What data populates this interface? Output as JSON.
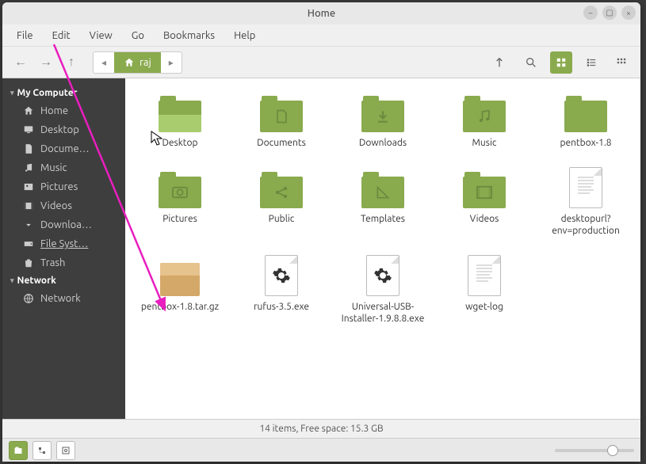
{
  "window": {
    "title": "Home"
  },
  "menu": {
    "items": [
      "File",
      "Edit",
      "View",
      "Go",
      "Bookmarks",
      "Help"
    ]
  },
  "path": {
    "current": "raj"
  },
  "sidebar": {
    "sections": [
      {
        "header": "My Computer",
        "items": [
          {
            "label": "Home",
            "icon": "home"
          },
          {
            "label": "Desktop",
            "icon": "desktop"
          },
          {
            "label": "Docume…",
            "icon": "doc"
          },
          {
            "label": "Music",
            "icon": "music"
          },
          {
            "label": "Pictures",
            "icon": "pic"
          },
          {
            "label": "Videos",
            "icon": "video"
          },
          {
            "label": "Downloa…",
            "icon": "down"
          },
          {
            "label": "File Syst…",
            "icon": "disk",
            "sel": true
          },
          {
            "label": "Trash",
            "icon": "trash"
          }
        ]
      },
      {
        "header": "Network",
        "items": [
          {
            "label": "Network",
            "icon": "net"
          }
        ]
      }
    ]
  },
  "files": [
    {
      "name": "Desktop",
      "type": "folder",
      "glyph": "desktop"
    },
    {
      "name": "Documents",
      "type": "folder",
      "glyph": "doc"
    },
    {
      "name": "Downloads",
      "type": "folder",
      "glyph": "down"
    },
    {
      "name": "Music",
      "type": "folder",
      "glyph": "music"
    },
    {
      "name": "pentbox-1.8",
      "type": "folder",
      "glyph": ""
    },
    {
      "name": "Pictures",
      "type": "folder",
      "glyph": "pic"
    },
    {
      "name": "Public",
      "type": "folder",
      "glyph": "share"
    },
    {
      "name": "Templates",
      "type": "folder",
      "glyph": "tmpl"
    },
    {
      "name": "Videos",
      "type": "folder",
      "glyph": "video"
    },
    {
      "name": "desktopurl?env=production",
      "type": "text"
    },
    {
      "name": "pentbox-1.8.tar.gz",
      "type": "archive"
    },
    {
      "name": "rufus-3.5.exe",
      "type": "exe"
    },
    {
      "name": "Universal-USB-Installer-1.9.8.8.exe",
      "type": "exe"
    },
    {
      "name": "wget-log",
      "type": "text"
    }
  ],
  "status": {
    "text": "14 items, Free space: 15.3 GB"
  }
}
